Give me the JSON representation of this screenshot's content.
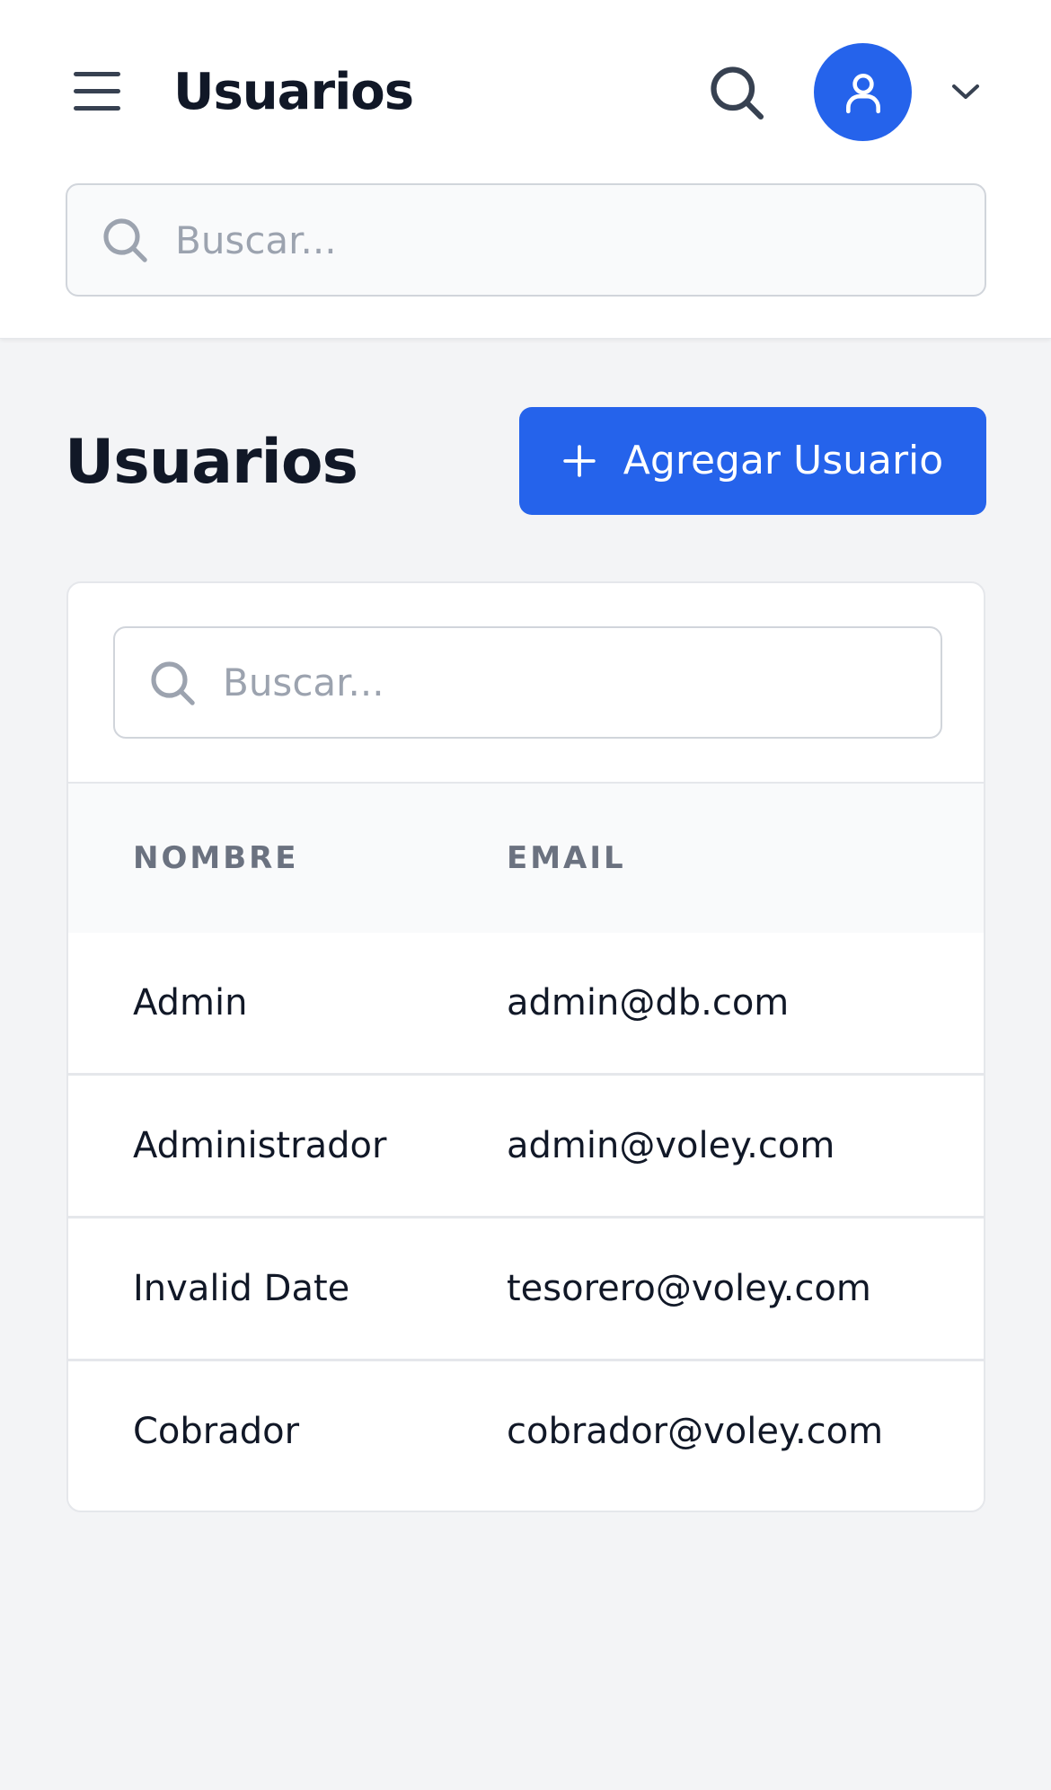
{
  "header": {
    "title": "Usuarios",
    "menu_icon": "hamburger-menu-icon",
    "search_icon": "search-icon",
    "avatar_icon": "user-icon",
    "chevron_icon": "chevron-down-icon",
    "search": {
      "placeholder": "Buscar...",
      "value": ""
    }
  },
  "main": {
    "title": "Usuarios",
    "add_button": {
      "label": "Agregar Usuario",
      "icon": "plus-icon"
    },
    "table_search": {
      "placeholder": "Buscar...",
      "value": ""
    },
    "table": {
      "columns": [
        "NOMBRE",
        "EMAIL"
      ],
      "rows": [
        {
          "nombre": "Admin",
          "email": "admin@db.com"
        },
        {
          "nombre": "Administrador",
          "email": "admin@voley.com"
        },
        {
          "nombre": "Invalid Date",
          "email": "tesorero@voley.com"
        },
        {
          "nombre": "Cobrador",
          "email": "cobrador@voley.com"
        }
      ]
    }
  },
  "colors": {
    "accent": "#2563eb",
    "background": "#f3f4f6",
    "surface": "#ffffff",
    "text": "#111827",
    "muted": "#6b7280"
  }
}
